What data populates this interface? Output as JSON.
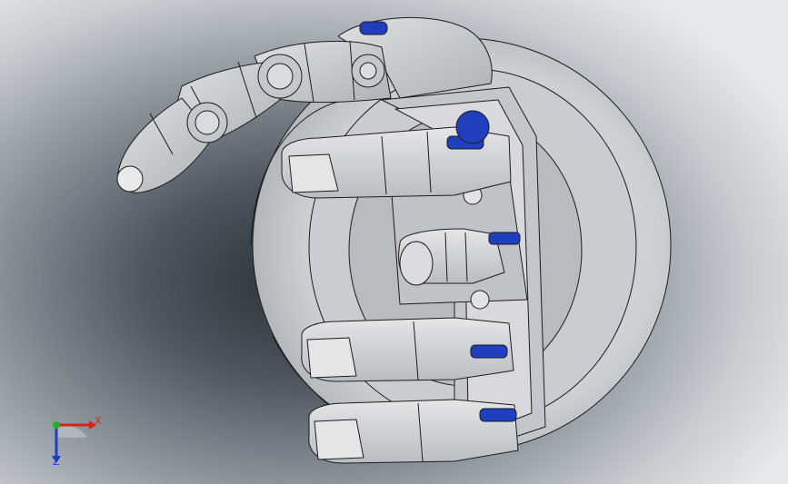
{
  "view": {
    "background_dark": "#2b3138",
    "background_light": "#e6e9ec",
    "part_fill": "#d3d6d9",
    "part_shade": "#b4b8bc",
    "edge_color": "#1c1c1c",
    "pin_color": "#1f3fbf"
  },
  "triad": {
    "x_label": "X",
    "z_label": "Z",
    "x_color": "#d8231b",
    "y_color": "#27b027",
    "z_color": "#1e3cc8"
  }
}
